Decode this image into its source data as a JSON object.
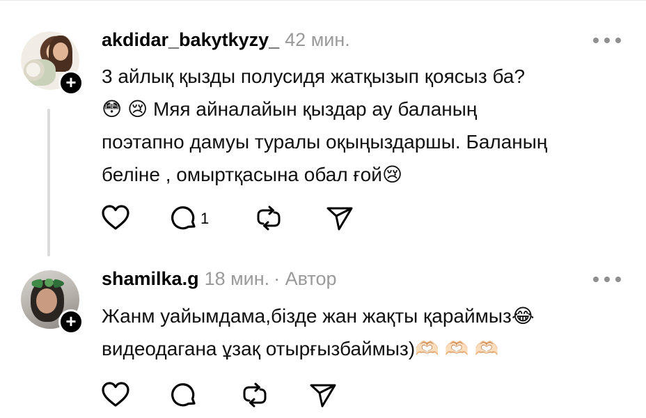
{
  "comments": [
    {
      "username": "akdidar_bakytkyzy_",
      "time": "42 мин.",
      "author_label": "",
      "text": "3 айлық қызды полусидя жатқызып қоясыз ба?\n😳 😢 Мяя айналайын қыздар ау баланың\nпоэтапно дамуы туралы оқыңыздаршы. Баланың\nбеліне , омыртқасына обал ғой😢",
      "reply_count": "1"
    },
    {
      "username": "shamilka.g",
      "time": "18 мин.",
      "author_label": "· Автор",
      "text": "Жанм уайымдама,бізде жан жақты қараймыз😂\nвидеодагана ұзақ отырғызбаймыз)🫶🏻 🫶🏻 🫶🏻",
      "reply_count": ""
    }
  ],
  "icons": {
    "like": "heart-icon",
    "reply": "comment-icon",
    "repost": "repost-icon",
    "share": "send-icon",
    "more": "more-dots-icon",
    "follow": "plus-icon"
  }
}
